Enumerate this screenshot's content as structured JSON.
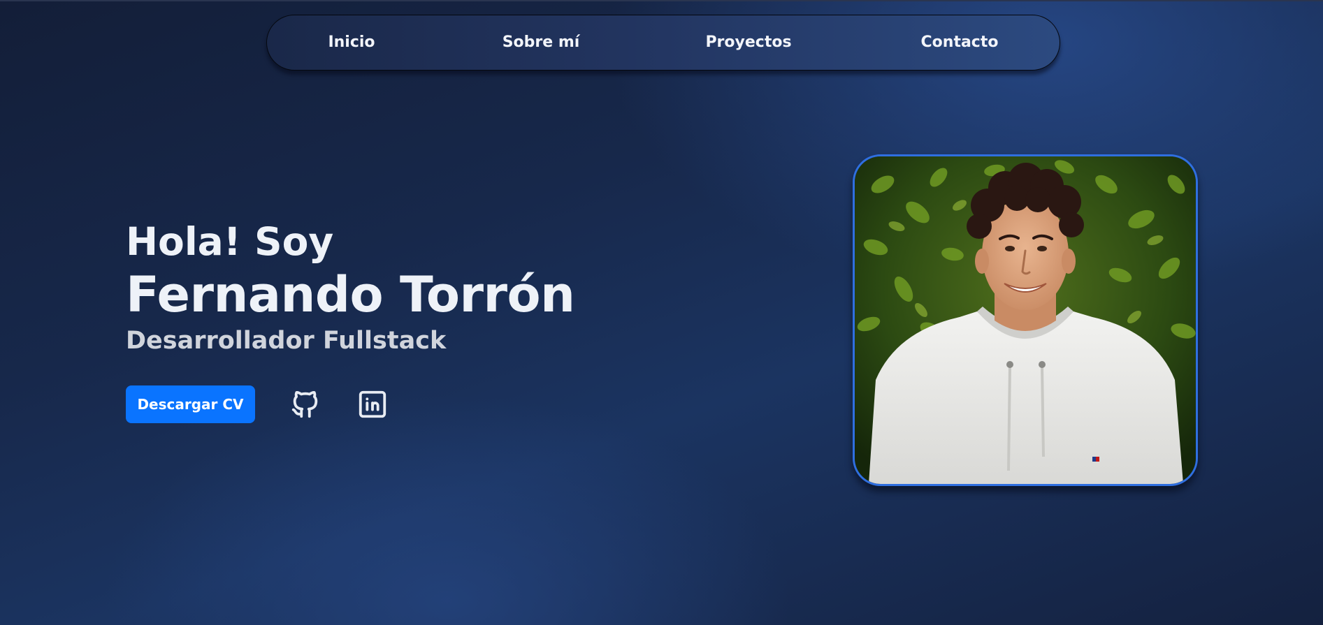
{
  "nav": {
    "items": [
      {
        "label": "Inicio"
      },
      {
        "label": "Sobre mí"
      },
      {
        "label": "Proyectos"
      },
      {
        "label": "Contacto"
      }
    ]
  },
  "hero": {
    "greeting": "Hola! Soy",
    "name": "Fernando Torrón",
    "role": "Desarrollador Fullstack",
    "cv_button_label": "Descargar CV",
    "social": [
      {
        "icon": "github-icon"
      },
      {
        "icon": "linkedin-icon"
      }
    ],
    "photo": {
      "subject": "profile-photo"
    }
  },
  "colors": {
    "accent": "#0a74ff",
    "photo_border": "#2f6fe0",
    "background": "#17284b",
    "text": "#eef2f8"
  }
}
